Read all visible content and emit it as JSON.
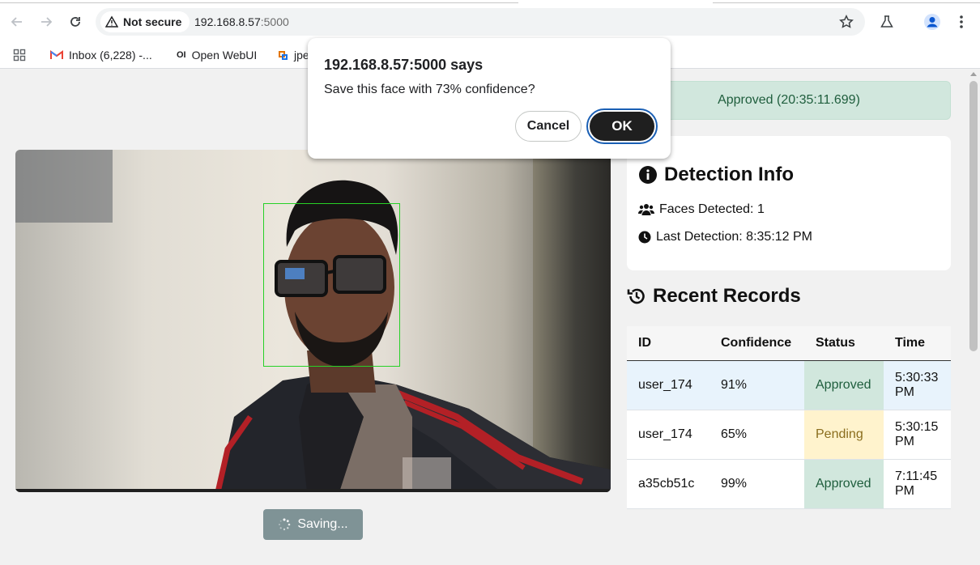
{
  "browser": {
    "security_label": "Not secure",
    "url_host": "192.168.8.57",
    "url_port": ":5000"
  },
  "bookmarks": [
    {
      "label": "Inbox (6,228) -..."
    },
    {
      "label": "Open WebUI"
    },
    {
      "label": "jpe"
    }
  ],
  "dialog": {
    "title": "192.168.8.57:5000 says",
    "message": "Save this face with 73% confidence?",
    "cancel_label": "Cancel",
    "ok_label": "OK"
  },
  "camera": {
    "save_button_label": "Saving..."
  },
  "status": {
    "text": "Approved (20:35:11.699)"
  },
  "detection": {
    "title": "Detection Info",
    "faces_detected": "Faces Detected: 1",
    "last_detection": "Last Detection: 8:35:12 PM"
  },
  "records": {
    "title": "Recent Records",
    "headers": [
      "ID",
      "Confidence",
      "Status",
      "Time"
    ],
    "rows": [
      {
        "id": "user_174",
        "confidence": "91%",
        "status": "Approved",
        "time": "5:30:33 PM"
      },
      {
        "id": "user_174",
        "confidence": "65%",
        "status": "Pending",
        "time": "5:30:15 PM"
      },
      {
        "id": "a35cb51c",
        "confidence": "99%",
        "status": "Approved",
        "time": "7:11:45 PM"
      }
    ]
  },
  "colors": {
    "approved_bg": "#d1e7dd",
    "pending_bg": "#fff3cd",
    "face_box": "#27d127"
  }
}
